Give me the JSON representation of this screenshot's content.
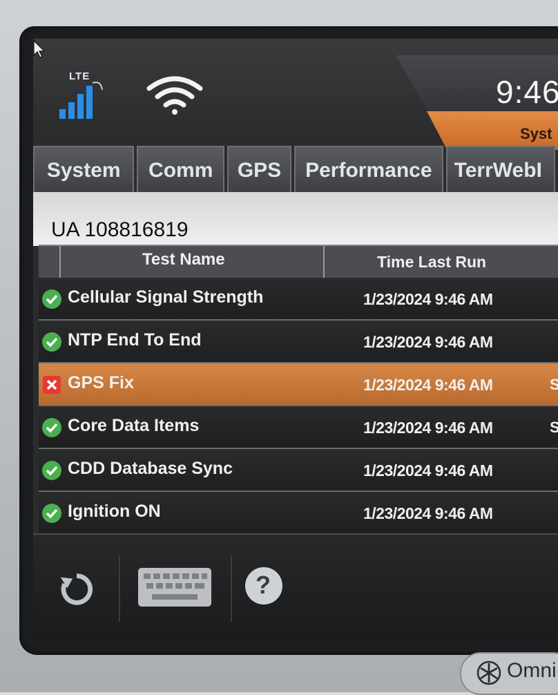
{
  "status": {
    "network_label": "LTE",
    "time": "9:46",
    "badge_label": "Syst"
  },
  "tabs": [
    {
      "label": "System"
    },
    {
      "label": "Comm"
    },
    {
      "label": "GPS"
    },
    {
      "label": "Performance"
    },
    {
      "label": "TerrWebI"
    }
  ],
  "unit_id": "UA 108816819",
  "table": {
    "columns": [
      "Test Name",
      "Time Last Run"
    ],
    "rows": [
      {
        "name": "Cellular Signal Strength",
        "time": "1/23/2024 9:46 AM",
        "status": "pass",
        "extra": ""
      },
      {
        "name": "NTP End To End",
        "time": "1/23/2024 9:46 AM",
        "status": "pass",
        "extra": ""
      },
      {
        "name": "GPS Fix",
        "time": "1/23/2024 9:46 AM",
        "status": "fail",
        "extra": "S"
      },
      {
        "name": "Core Data Items",
        "time": "1/23/2024 9:46 AM",
        "status": "pass",
        "extra": "S"
      },
      {
        "name": "CDD Database Sync",
        "time": "1/23/2024 9:46 AM",
        "status": "pass",
        "extra": ""
      },
      {
        "name": "Ignition ON",
        "time": "1/23/2024 9:46 AM",
        "status": "pass",
        "extra": ""
      }
    ]
  },
  "toolbar": {
    "refresh_icon": "refresh-icon",
    "keyboard_icon": "keyboard-icon",
    "help_icon": "help-icon",
    "help_glyph": "?"
  },
  "brand": {
    "label": "Omni"
  },
  "colors": {
    "pass": "#4caf50",
    "fail": "#e53935",
    "accent": "#d9833f"
  }
}
